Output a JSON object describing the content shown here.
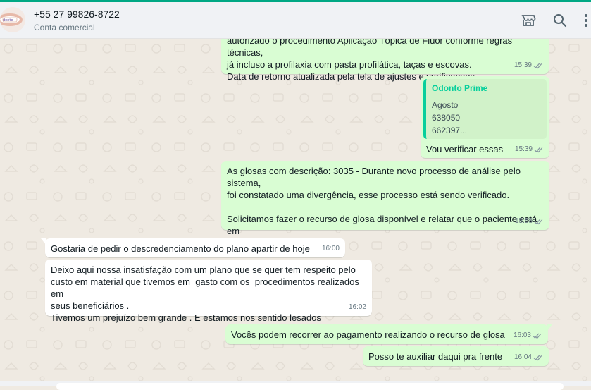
{
  "header": {
    "contact_name": "+55 27 99826-8722",
    "contact_subtitle": "Conta comercial",
    "icons": [
      "catalog-shop-icon",
      "search-icon",
      "menu-kebab-icon"
    ]
  },
  "messages": [
    {
      "direction": "out",
      "text": "autorizado o procedimento Aplicação Tópica de Flúor conforme regras técnicas,\njá incluso a profilaxia com pasta profilática, taças e escovas.\nData de retorno atualizada pela tela de ajustes e verificacoes.",
      "time": "15:39",
      "status": "read"
    },
    {
      "direction": "out",
      "quote": {
        "author": "Odonto Prime",
        "lines": [
          "Agosto",
          "638050",
          "662397..."
        ]
      },
      "text": "Vou verificar essas",
      "time": "15:39",
      "status": "read"
    },
    {
      "direction": "out",
      "text": "As glosas com descrição: 3035 - Durante novo processo de análise pelo sistema,\nfoi constatado uma divergência, esse processo está sendo verificado.\n\nSolicitamos fazer o recurso de glosa disponível e relatar que o paciente está em\ntratamento.",
      "time": "15:58",
      "status": "read"
    },
    {
      "direction": "in",
      "text": "Gostaria de pedir o descredenciamento do plano apartir de hoje",
      "time": "16:00"
    },
    {
      "direction": "in",
      "text": "Deixo aqui nossa insatisfação com um plano que se quer tem respeito pelo\ncusto em material que tivemos em  gasto com os  procedimentos realizados em\nseus beneficiários .\nTivemos um prejuízo bem grande . E estamos nos sentido lesados",
      "time": "16:02"
    },
    {
      "direction": "out",
      "text": "Vocês podem recorrer ao pagamento realizando o recurso de glosa",
      "time": "16:03",
      "status": "read"
    },
    {
      "direction": "out",
      "text": "Posso te auxiliar daqui pra frente",
      "time": "16:04",
      "status": "read"
    }
  ],
  "colors": {
    "accent": "#00a884",
    "outgoing_bubble": "#d9fdd3",
    "incoming_bubble": "#ffffff",
    "chat_background": "#efeae2",
    "read_ticks": "#8696a0",
    "quote_author": "#06cf9c"
  }
}
